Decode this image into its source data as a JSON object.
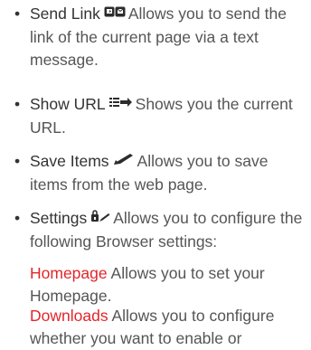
{
  "items": [
    {
      "term": "Send Link",
      "icon": "send-link-icon",
      "description": "Allows you to send the link of the current page via a text message."
    },
    {
      "term": "Show URL",
      "icon": "show-url-icon",
      "description": "Shows you the current URL."
    },
    {
      "term": "Save Items",
      "icon": "save-items-icon",
      "description": "Allows you to save items from the web page."
    },
    {
      "term": "Settings",
      "icon": "settings-icon",
      "description": "Allows you to configure the following Browser settings:"
    }
  ],
  "settings_options": [
    {
      "term": "Homepage",
      "description": "Allows you to set your Homepage."
    },
    {
      "term": "Downloads",
      "description": "Allows you to configure whether you want to enable or"
    }
  ],
  "colors": {
    "text": "#555555",
    "term": "#333333",
    "option_term": "#e2262b"
  }
}
